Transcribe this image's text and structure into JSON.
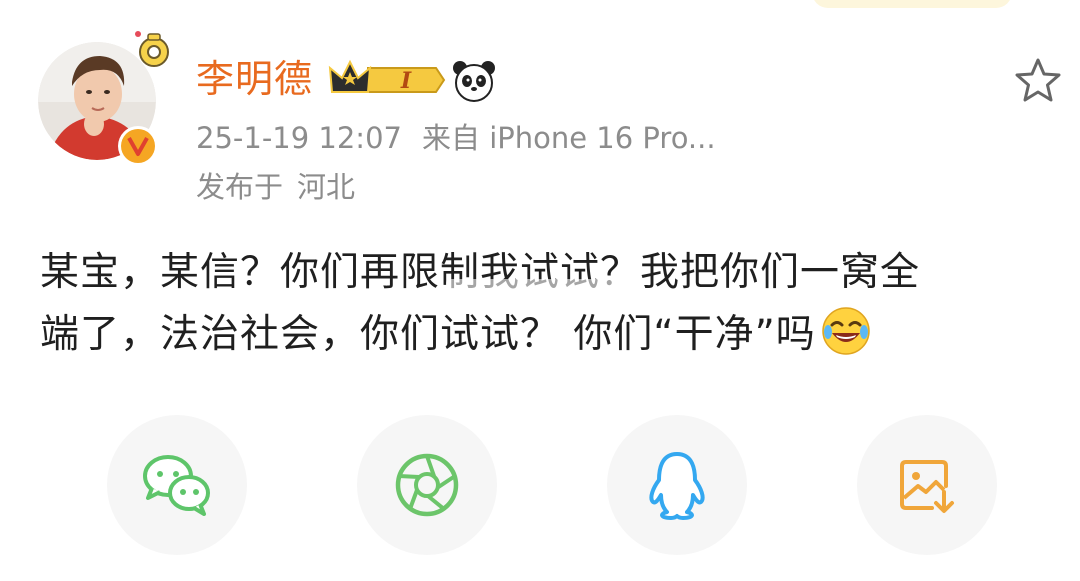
{
  "post": {
    "author": "李明德",
    "timestamp": "25-1-19 12:07",
    "source": "来自 iPhone 16 Pro...",
    "location_prefix": "发布于",
    "location": "河北",
    "text_line1": "某宝，某信？你们再限制我试试？我把你们一窝全",
    "text_line2": "端了，法治社会，你们试试？ 你们“干净”吗",
    "crown_badge_text": "I"
  },
  "icons": {
    "star": "star-outline-icon",
    "panda": "panda-icon",
    "laugh": "laugh-cry-emoji-icon",
    "verified": "verified-v-icon"
  },
  "share": [
    {
      "name": "wechat",
      "icon": "wechat-icon",
      "color": "#5ec56a"
    },
    {
      "name": "moments",
      "icon": "moments-aperture-icon",
      "color": "#6cc56a"
    },
    {
      "name": "qq",
      "icon": "qq-penguin-icon",
      "color": "#34a8f0"
    },
    {
      "name": "save-image",
      "icon": "save-image-icon",
      "color": "#f0a63a"
    }
  ],
  "colors": {
    "username": "#e86a1f",
    "meta": "#8c8c8c",
    "text": "#1f1f1f",
    "verified_badge": "#f5a623",
    "share_bg": "#f6f6f6"
  }
}
